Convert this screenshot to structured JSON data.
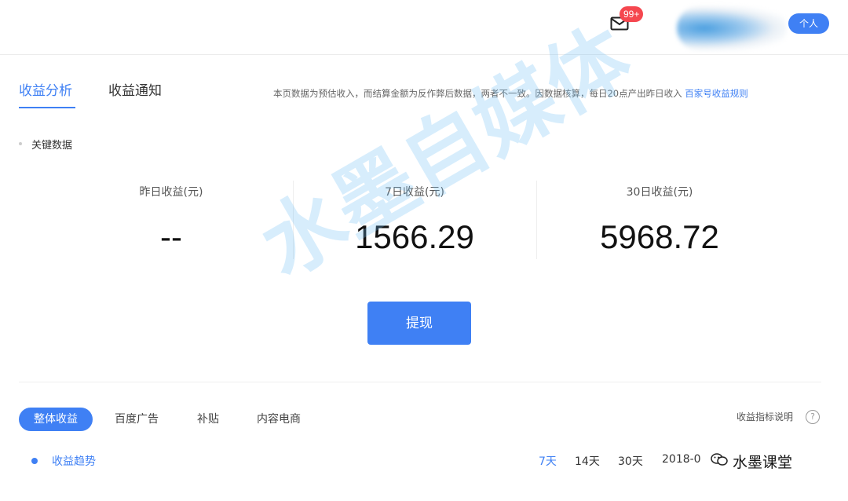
{
  "header": {
    "badge": "99+",
    "user_label": "个人"
  },
  "tabs": {
    "analysis": "收益分析",
    "notice": "收益通知"
  },
  "notice": {
    "text": "本页数据为预估收入，而结算金额为反作弊后数据，两者不一致。因数据核算，每日20点产出昨日收入",
    "link": "百家号收益规则"
  },
  "key_data": {
    "title": "关键数据",
    "stats": [
      {
        "label": "昨日收益(元)",
        "value": "--"
      },
      {
        "label": "7日收益(元)",
        "value": "1566.29"
      },
      {
        "label": "30日收益(元)",
        "value": "5968.72"
      }
    ]
  },
  "withdraw_label": "提现",
  "sub_tabs": [
    "整体收益",
    "百度广告",
    "补贴",
    "内容电商"
  ],
  "help": {
    "text": "收益指标说明",
    "icon": "?"
  },
  "trend": {
    "title": "收益趋势",
    "ranges": [
      "7天",
      "14天",
      "30天"
    ],
    "date": "2018-0"
  },
  "watermarks": {
    "big": "水墨自媒体",
    "small": "水墨课堂"
  },
  "colors": {
    "accent": "#3f80f4",
    "badge": "#f5474f"
  },
  "icons": [
    "mail-icon",
    "help-icon",
    "wechat-icon"
  ]
}
